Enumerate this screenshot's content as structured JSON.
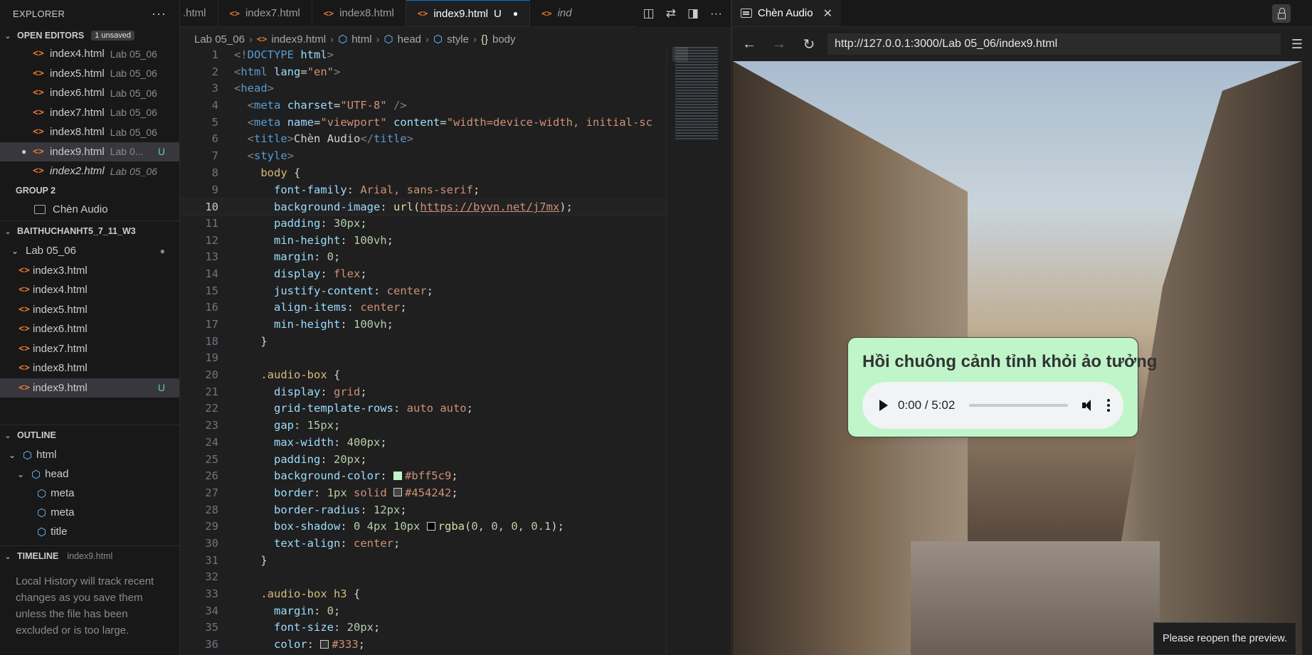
{
  "sidebar": {
    "title": "EXPLORER",
    "open_editors": {
      "label": "OPEN EDITORS",
      "badge": "1 unsaved",
      "items": [
        {
          "name": "index4.html",
          "folder": "Lab 05_06"
        },
        {
          "name": "index5.html",
          "folder": "Lab 05_06"
        },
        {
          "name": "index6.html",
          "folder": "Lab 05_06"
        },
        {
          "name": "index7.html",
          "folder": "Lab 05_06"
        },
        {
          "name": "index8.html",
          "folder": "Lab 05_06"
        },
        {
          "name": "index9.html",
          "folder": "Lab 0...",
          "status": "U"
        },
        {
          "name": "index2.html",
          "folder": "Lab 05_06"
        }
      ],
      "group2": "GROUP 2",
      "group2_item": "Chèn Audio"
    },
    "workspace": {
      "label": "BAITHUCHANHT5_7_11_W3",
      "folder": "Lab 05_06",
      "files": [
        "index3.html",
        "index4.html",
        "index5.html",
        "index6.html",
        "index7.html",
        "index8.html",
        "index9.html"
      ],
      "selected_status": "U"
    },
    "outline": {
      "label": "OUTLINE",
      "items": [
        "html",
        "head",
        "meta",
        "meta",
        "title"
      ]
    },
    "timeline": {
      "label": "TIMELINE",
      "file": "index9.html",
      "message": "Local History will track recent changes as you save them unless the file has been excluded or is too large."
    }
  },
  "editor": {
    "tabs": [
      {
        "label": ".html"
      },
      {
        "label": "index7.html"
      },
      {
        "label": "index8.html"
      },
      {
        "label": "index9.html",
        "status": "U"
      },
      {
        "label": "ind"
      }
    ],
    "breadcrumb": [
      "Lab 05_06",
      "index9.html",
      "html",
      "head",
      "style",
      "body"
    ],
    "current_line": 10
  },
  "preview": {
    "tab_title": "Chèn Audio",
    "url": "http://127.0.0.1:3000/Lab 05_06/index9.html",
    "heading": "Hồi chuông cảnh tỉnh khỏi ảo tưởng",
    "player_time": "0:00 / 5:02",
    "progress": 0,
    "toast": "Please reopen the preview.",
    "box_color": "#bff5c9"
  }
}
